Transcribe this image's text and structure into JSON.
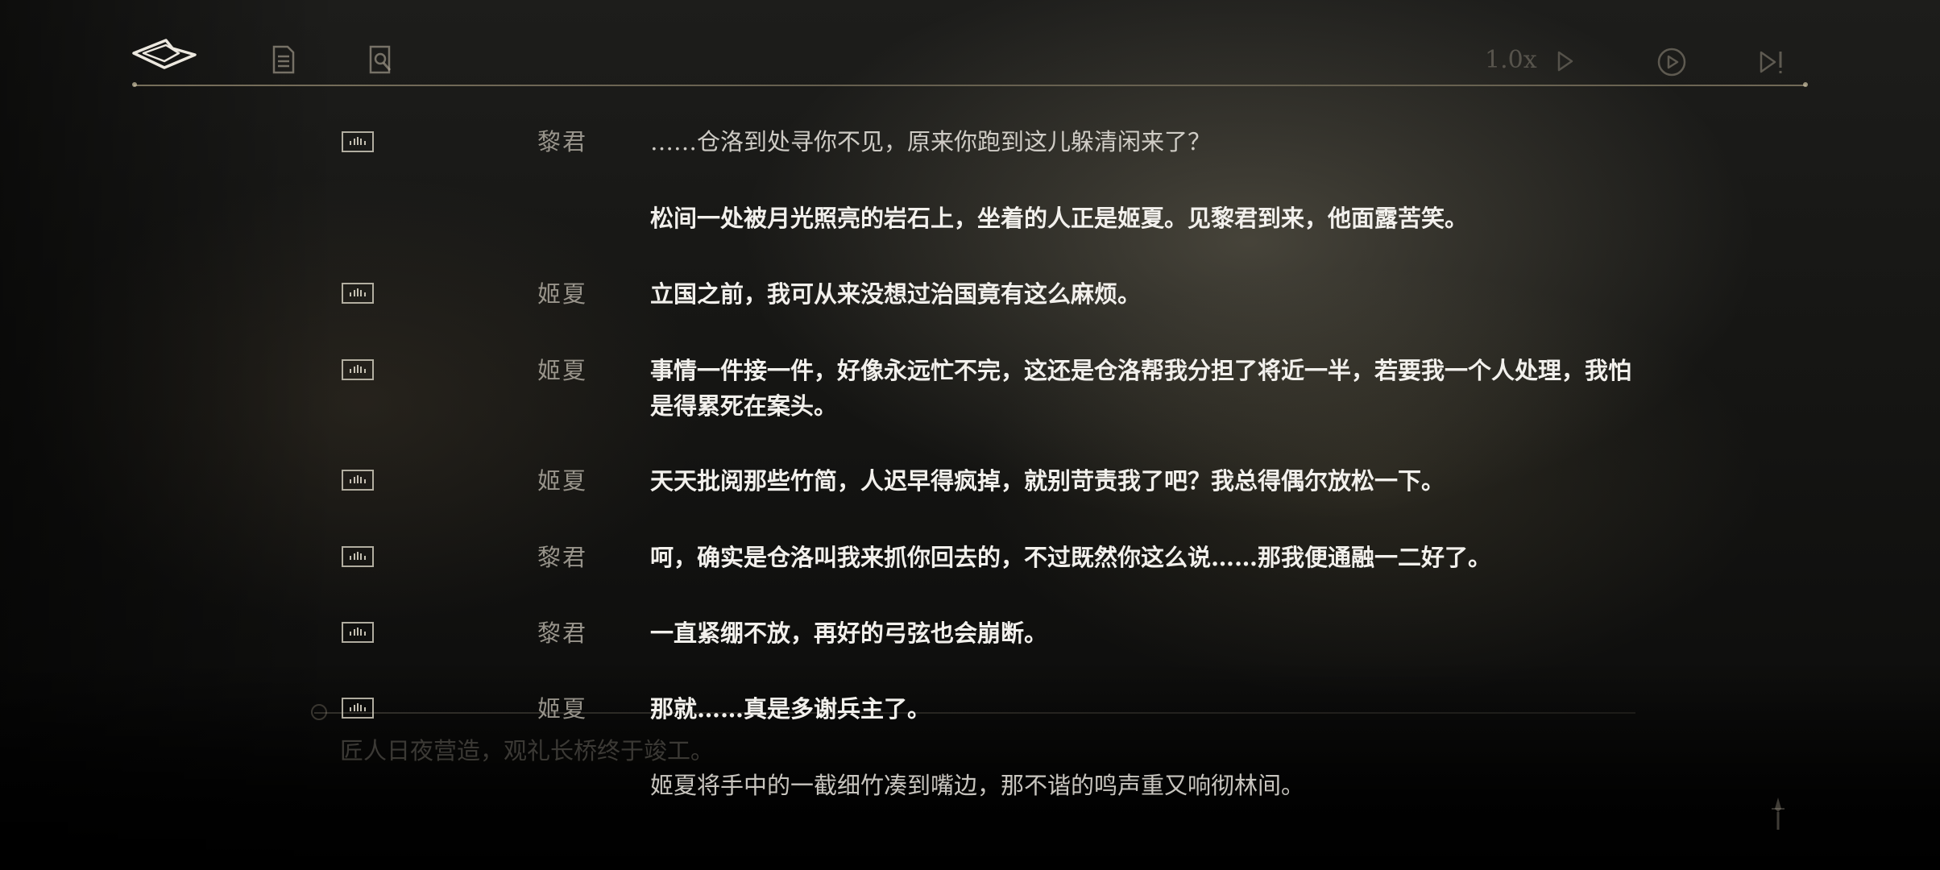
{
  "toolbar": {
    "back_icon": "back-arrow-icon",
    "log_icon": "document-icon",
    "search_icon": "magnify-book-icon",
    "speed_label": "1.0x",
    "play_icon": "play-triangle-icon",
    "auto_icon": "auto-play-circle-icon",
    "skip_icon": "skip-icon"
  },
  "dialogue": [
    {
      "speaker": "黎君",
      "has_voice": true,
      "text": "……仓洛到处寻你不见，原来你跑到这儿躲清闲来了？"
    },
    {
      "speaker": "",
      "has_voice": false,
      "text": "松间一处被月光照亮的岩石上，坐着的人正是姬夏。见黎君到来，他面露苦笑。"
    },
    {
      "speaker": "姬夏",
      "has_voice": true,
      "text": "立国之前，我可从来没想过治国竟有这么麻烦。"
    },
    {
      "speaker": "姬夏",
      "has_voice": true,
      "text": "事情一件接一件，好像永远忙不完，这还是仓洛帮我分担了将近一半，若要我一个人处理，我怕是得累死在案头。"
    },
    {
      "speaker": "姬夏",
      "has_voice": true,
      "text": "天天批阅那些竹简，人迟早得疯掉，就别苛责我了吧？我总得偶尔放松一下。"
    },
    {
      "speaker": "黎君",
      "has_voice": true,
      "text": "呵，确实是仓洛叫我来抓你回去的，不过既然你这么说……那我便通融一二好了。"
    },
    {
      "speaker": "黎君",
      "has_voice": true,
      "text": "一直紧绷不放，再好的弓弦也会崩断。"
    },
    {
      "speaker": "姬夏",
      "has_voice": true,
      "text": "那就……真是多谢兵主了。"
    },
    {
      "speaker": "",
      "has_voice": false,
      "text": "姬夏将手中的一截细竹凑到嘴边，那不谐的鸣声重又响彻林间。"
    }
  ],
  "background_subtitle": "匠人日夜营造，观礼长桥终于竣工。",
  "colors": {
    "text_primary": "#f2f0ec",
    "speaker": "#afaaa0",
    "accent_line": "#c8b996",
    "background": "#0c0c0c"
  }
}
